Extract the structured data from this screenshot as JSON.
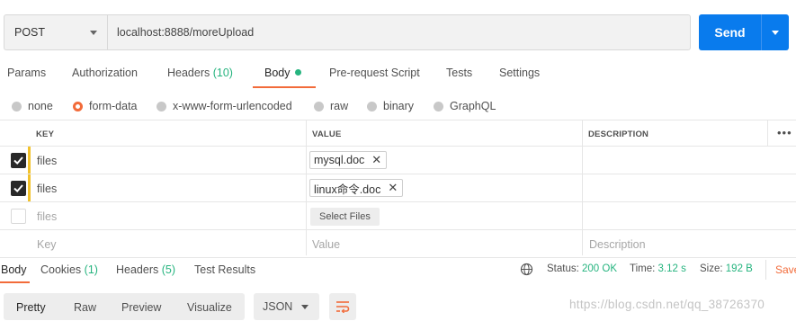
{
  "request": {
    "method": "POST",
    "url": "localhost:8888/moreUpload",
    "send_label": "Send"
  },
  "tabs": [
    {
      "label": "Params"
    },
    {
      "label": "Authorization"
    },
    {
      "label": "Headers",
      "count": "(10)"
    },
    {
      "label": "Body",
      "active": true
    },
    {
      "label": "Pre-request Script"
    },
    {
      "label": "Tests"
    },
    {
      "label": "Settings"
    }
  ],
  "body_types": [
    {
      "label": "none"
    },
    {
      "label": "form-data",
      "selected": true
    },
    {
      "label": "x-www-form-urlencoded"
    },
    {
      "label": "raw"
    },
    {
      "label": "binary"
    },
    {
      "label": "GraphQL"
    }
  ],
  "table": {
    "headers": {
      "key": "KEY",
      "value": "VALUE",
      "description": "DESCRIPTION"
    },
    "rows": [
      {
        "key": "files",
        "value": "mysql.doc",
        "checked": true
      },
      {
        "key": "files",
        "value": "linux命令.doc",
        "checked": true
      },
      {
        "key": "files",
        "select_label": "Select Files",
        "checked": false
      }
    ],
    "placeholder": {
      "key": "Key",
      "value": "Value",
      "description": "Description"
    }
  },
  "response": {
    "tabs": [
      {
        "label": "Body",
        "active": true
      },
      {
        "label": "Cookies",
        "count": "(1)"
      },
      {
        "label": "Headers",
        "count": "(5)"
      },
      {
        "label": "Test Results"
      }
    ],
    "status_label": "Status:",
    "status_value": "200 OK",
    "time_label": "Time:",
    "time_value": "3.12 s",
    "size_label": "Size:",
    "size_value": "192 B",
    "save_label": "Save"
  },
  "view": {
    "modes": [
      "Pretty",
      "Raw",
      "Preview",
      "Visualize"
    ],
    "active_mode": "Pretty",
    "format": "JSON"
  },
  "watermark": "https://blog.csdn.net/qq_38726370",
  "colors": {
    "accent": "#f26b3a",
    "send": "#097bed",
    "success": "#26b47f",
    "row_marker": "#f2c22c"
  }
}
